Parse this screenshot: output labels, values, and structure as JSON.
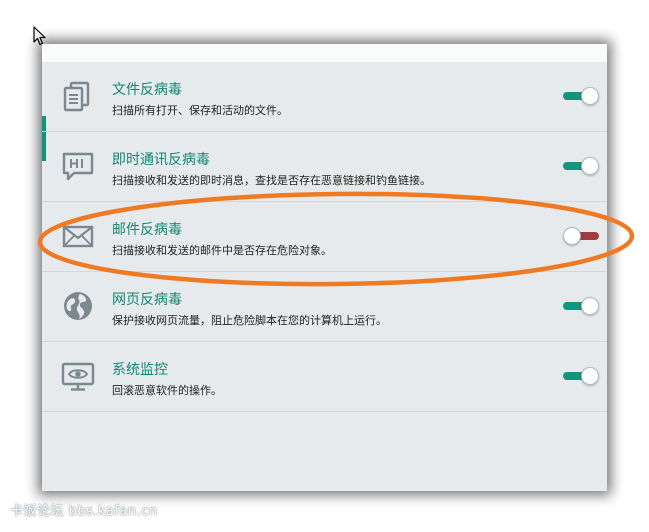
{
  "protection_list": [
    {
      "title": "文件反病毒",
      "description": "扫描所有打开、保存和活动的文件。",
      "icon": "file-copy-icon",
      "enabled": true
    },
    {
      "title": "即时通讯反病毒",
      "description": "扫描接收和发送的即时消息，查找是否存在恶意链接和钓鱼链接。",
      "icon": "chat-bubble-icon",
      "enabled": true
    },
    {
      "title": "邮件反病毒",
      "description": "扫描接收和发送的邮件中是否存在危险对象。",
      "icon": "mail-envelope-icon",
      "enabled": false
    },
    {
      "title": "网页反病毒",
      "description": "保护接收网页流量，阻止危险脚本在您的计算机上运行。",
      "icon": "globe-icon",
      "enabled": true
    },
    {
      "title": "系统监控",
      "description": "回滚恶意软件的操作。",
      "icon": "monitor-eye-icon",
      "enabled": true
    }
  ],
  "watermark": "卡饭论坛 bbs.kafan.cn",
  "colors": {
    "accent": "#12876f",
    "toggle_on": "#14957e",
    "toggle_off": "#a33a3f",
    "annotation": "#f07a23"
  }
}
